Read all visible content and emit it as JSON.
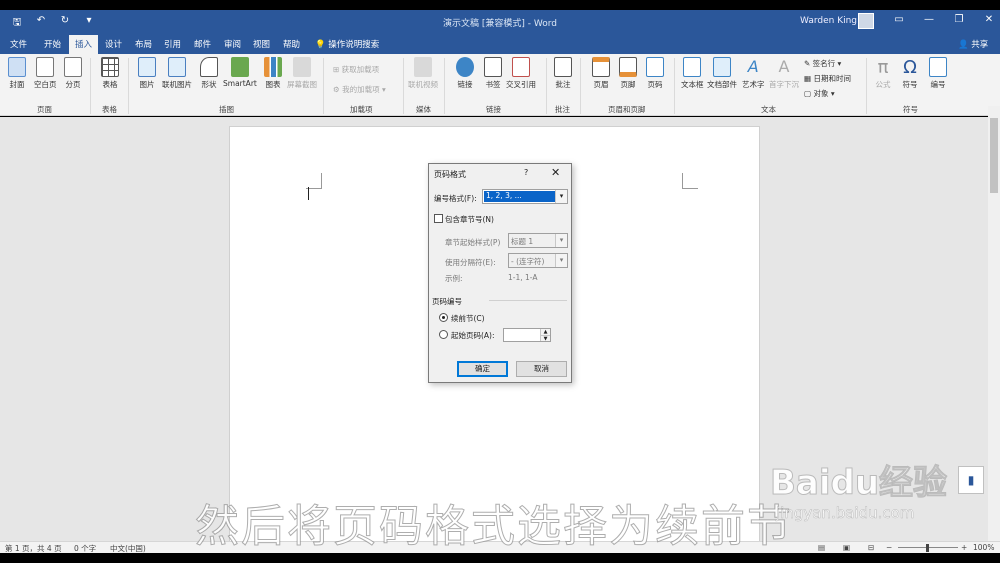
{
  "window": {
    "title": "演示文稿 [兼容模式] - Word",
    "user": "Warden King",
    "controls": [
      "▭",
      "—",
      "❐",
      "✕"
    ]
  },
  "qat": [
    "🖫",
    "↶",
    "↻",
    "▾"
  ],
  "tabs": [
    "文件",
    "开始",
    "插入",
    "设计",
    "布局",
    "引用",
    "邮件",
    "审阅",
    "视图",
    "帮助"
  ],
  "active_tab": "插入",
  "tell_me": "操作说明搜索",
  "share": "共享",
  "ribbon": {
    "buttons": {
      "cover": "封面",
      "blank": "空白页",
      "pagebreak": "分页",
      "table": "表格",
      "picture": "图片",
      "online_picture": "联机图片",
      "shapes": "形状",
      "smartart": "SmartArt",
      "chart": "图表",
      "screenshot": "屏幕截图",
      "get_addins": "获取加载项",
      "my_addins": "我的加载项",
      "online_video": "联机视频",
      "link": "链接",
      "bookmark": "书签",
      "crossref": "交叉引用",
      "comment": "批注",
      "header": "页眉",
      "footer": "页脚",
      "pagenum": "页码",
      "textbox": "文本框",
      "quickparts": "文档部件",
      "wordart": "艺术字",
      "dropcap": "首字下沉",
      "signature": "签名行",
      "datetime": "日期和时间",
      "object": "对象",
      "equation": "公式",
      "symbol": "符号",
      "number": "编号"
    },
    "groups": {
      "pages": "页面",
      "tables": "表格",
      "illustrations": "插图",
      "addins": "加载项",
      "media": "媒体",
      "links": "链接",
      "comments": "批注",
      "headerfooter": "页眉和页脚",
      "text": "文本",
      "symbols": "符号"
    }
  },
  "dialog": {
    "title": "页码格式",
    "help": "?",
    "close": "✕",
    "number_format_label": "编号格式(F):",
    "number_format_value": "1, 2, 3, ...",
    "include_chapter_label": "包含章节号(N)",
    "chapter_style_label": "章节起始样式(P)",
    "chapter_style_value": "标题 1",
    "separator_label": "使用分隔符(E):",
    "separator_value": "-  (连字符)",
    "example_label": "示例:",
    "example_value": "1-1, 1-A",
    "page_numbering_label": "页码编号",
    "continue_label": "续前节(C)",
    "start_at_label": "起始页码(A):",
    "ok": "确定",
    "cancel": "取消"
  },
  "status": {
    "page": "第 1 页，共 4 页",
    "words": "0 个字",
    "language": "中文(中国)",
    "zoom": "100%"
  },
  "overlay": {
    "caption": "然后将页码格式选择为续前节",
    "brand": "Baidu经验",
    "url": "jingyan.baidu.com"
  }
}
